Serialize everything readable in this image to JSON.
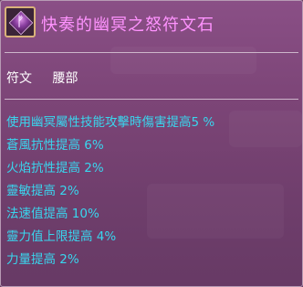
{
  "item": {
    "name": "快奏的幽冥之怒符文石",
    "icon": "rune-gem-icon",
    "name_color": "#ff93ff"
  },
  "slot": {
    "label": "符文",
    "value": "腰部"
  },
  "effects": [
    "使用幽冥屬性技能攻擊時傷害提高5 %",
    "蒼風抗性提高 6%",
    "火焰抗性提高 2%",
    "靈敏提高 2%",
    "法速值提高 10%",
    "靈力值上限提高 4%",
    "力量提高 2%"
  ],
  "colors": {
    "effect_text": "#39d6ee",
    "panel_bg": "#7c4577"
  }
}
